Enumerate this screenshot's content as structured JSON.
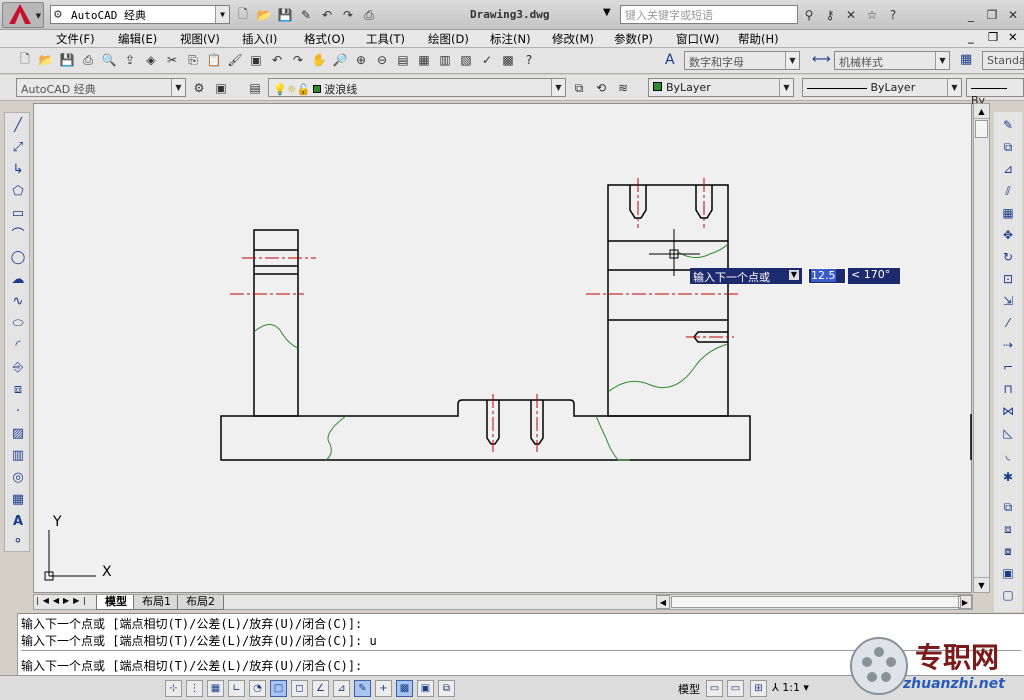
{
  "window": {
    "title": "Drawing3.dwg",
    "workspace": "AutoCAD 经典",
    "search_placeholder": "键入关键字或短语"
  },
  "menu": [
    "文件(F)",
    "编辑(E)",
    "视图(V)",
    "插入(I)",
    "格式(O)",
    "工具(T)",
    "绘图(D)",
    "标注(N)",
    "修改(M)",
    "参数(P)",
    "窗口(W)",
    "帮助(H)"
  ],
  "toolbar2": {
    "text_style": "数字和字母",
    "dim_style": "机械样式",
    "table_style": "Standa"
  },
  "toolbar3": {
    "workspace": "AutoCAD 经典",
    "layer": "波浪线",
    "color": "ByLayer",
    "linetype": "ByLayer",
    "lineweight": "By"
  },
  "canvas": {
    "dyn_prompt": "输入下一个点或",
    "dyn_value": "12.5",
    "dyn_angle": "< 170°",
    "ucs_y": "Y",
    "ucs_x": "X"
  },
  "layout_tabs": [
    "模型",
    "布局1",
    "布局2"
  ],
  "command": {
    "line1": "输入下一个点或 [端点相切(T)/公差(L)/放弃(U)/闭合(C)]:",
    "line2": "输入下一个点或 [端点相切(T)/公差(L)/放弃(U)/闭合(C)]: u",
    "line3": "输入下一个点或 [端点相切(T)/公差(L)/放弃(U)/闭合(C)]:"
  },
  "status": {
    "model": "模型",
    "scale": "1:1"
  },
  "watermark": {
    "cn": "专职网",
    "en": "zhuanzhi.net"
  },
  "colors": {
    "accent": "#c8102e",
    "drawing_red": "#c00000",
    "wave_green": "#2e8b2e",
    "dyn_bg": "#1e2a6e"
  }
}
